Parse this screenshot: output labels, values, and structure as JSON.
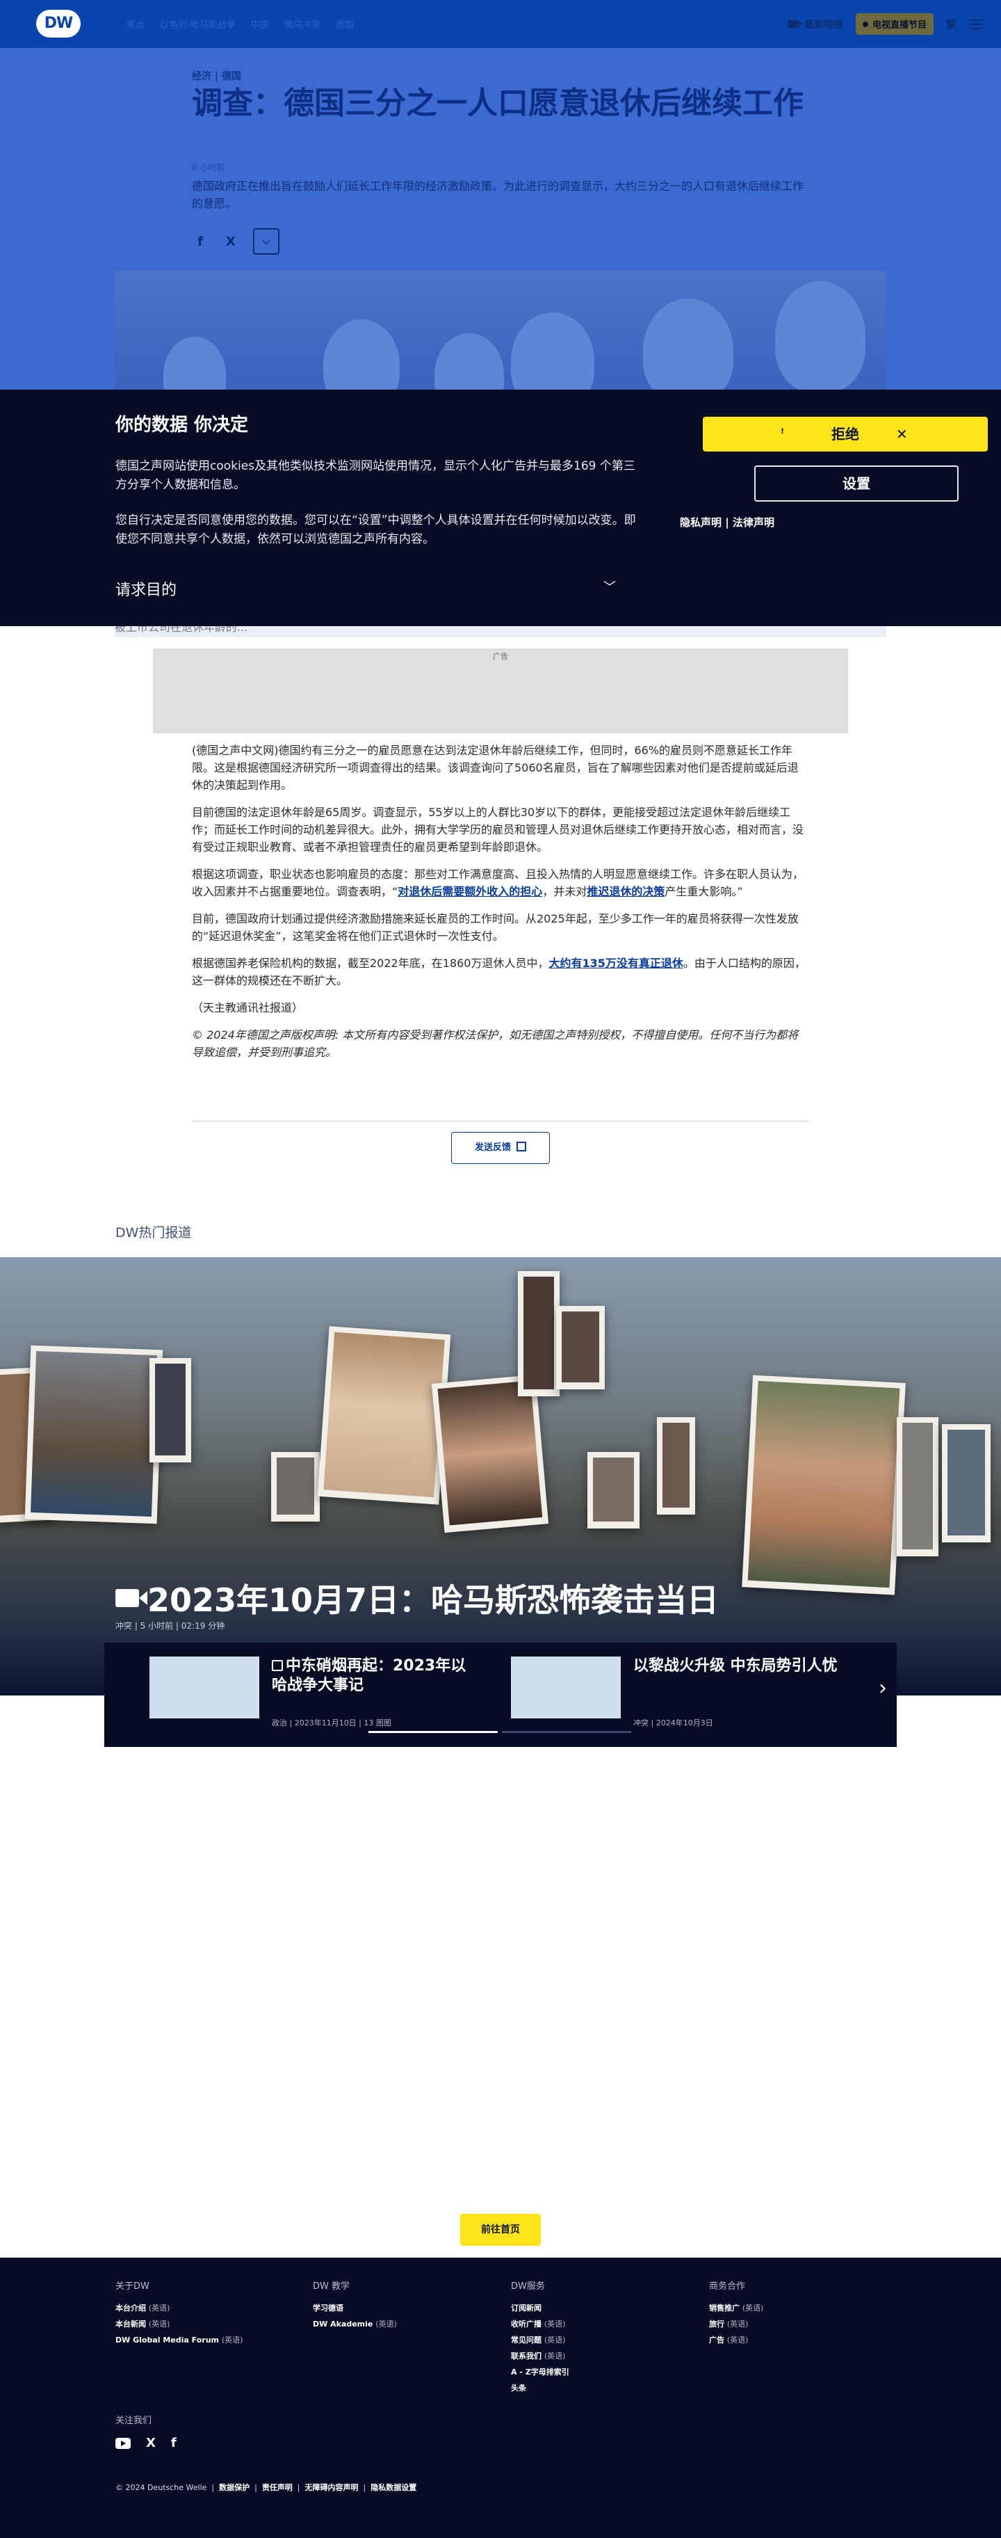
{
  "brand": {
    "logo_text": "DW"
  },
  "nav": {
    "links": [
      "焦点",
      "以色列-哈马斯战争",
      "中国",
      "俄乌冲突",
      "德国"
    ],
    "latest_label": "最新视频",
    "live_label": "电视直播节目",
    "lang_label": "繁"
  },
  "article": {
    "kicker": "经济 | 德国",
    "title": "调查：德国三分之一人口愿意退休后继续工作",
    "time": "6 小时前",
    "teaser": "德国政府正在推出旨在鼓励人们延长工作年限的经济激励政策。为此进行的调查显示，大约三分之一的人口有退休后继续工作的意愿。",
    "share": {
      "facebook": "f",
      "x": "X",
      "more": "⌵"
    }
  },
  "cookie": {
    "title": "你的数据 你决定",
    "p1": "德国之声网站使用cookies及其他类似技术监测网站使用情况，显示个人化广告并与最多169 个第三方分享个人数据和信息。",
    "p2": "您自行决定是否同意使用您的数据。您可以在“设置”中调整个人具体设置并在任何时候加以改变。即使您不同意共享个人数据，依然可以浏览德国之声所有内容。",
    "purposes_label": "请求目的",
    "reject_label": "拒绝",
    "settings_label": "设置",
    "privacy_link": "隐私声明",
    "legal_link": "法律声明",
    "link_sep": "|"
  },
  "body": {
    "subbar_text": "被上市公司在退休年龄的...",
    "ad_label": "广告",
    "p1": "(德国之声中文网)德国约有三分之一的雇员愿意在达到法定退休年龄后继续工作，但同时，66%的雇员则不愿意延长工作年限。这是根据德国经济研究所一项调查得出的结果。该调查询问了5060名雇员，旨在了解哪些因素对他们是否提前或延后退休的决策起到作用。",
    "p2": "目前德国的法定退休年龄是65周岁。调查显示，55岁以上的人群比30岁以下的群体，更能接受超过法定退休年龄后继续工作；而延长工作时间的动机差异很大。此外，拥有大学学历的雇员和管理人员对退休后继续工作更持开放心态，相对而言，没有受过正规职业教育、或者不承担管理责任的雇员更希望到年龄即退休。",
    "p3_before": "根据这项调查，职业状态也影响雇员的态度：那些对工作满意度高、且投入热情的人明显愿意继续工作。许多在职人员认为，收入因素并不占据重要地位。调查表明，“",
    "p3_link1": "对退休后需要额外收入的担心",
    "p3_mid": "，并未对",
    "p3_link2": "推迟退休的决策",
    "p3_after": "产生重大影响。”",
    "p4": "目前，德国政府计划通过提供经济激励措施来延长雇员的工作时间。从2025年起，至少多工作一年的雇员将获得一次性发放的“延迟退休奖金”，这笔奖金将在他们正式退休时一次性支付。",
    "p5_before": "根据德国养老保险机构的数据，截至2022年底，在1860万退休人员中，",
    "p5_link": "大约有135万没有真正退休",
    "p5_after": "。由于人口结构的原因，这一群体的规模还在不断扩大。",
    "p6": "（天主教通讯社报道）",
    "copyright": "© 2024年德国之声版权声明: 本文所有内容受到著作权法保护，如无德国之声特别授权，不得擅自使用。任何不当行为都将导致追偿，并受到刑事追究。",
    "feedback_label": "发送反馈"
  },
  "hot": {
    "section_title": "DW热门报道",
    "title": "2023年10月7日：哈马斯恐怖袭击当日",
    "meta": "冲突 | 5 小时前 | 02:19 分钟",
    "cards": [
      {
        "title": "中东硝烟再起：2023年以哈战争大事记",
        "meta": "政治 | 2023年11月10日 | 13 图图"
      },
      {
        "title": "以黎战火升级 中东局势引人忧",
        "meta": "冲突 | 2024年10月3日"
      }
    ],
    "next_icon": "›"
  },
  "home_button_label": "前往首页",
  "footer": {
    "cols": [
      {
        "title": "关于DW",
        "items": [
          {
            "label": "本台介绍",
            "lang": "(英语)"
          },
          {
            "label": "本台新闻",
            "lang": "(英语)"
          },
          {
            "label": "DW Global Media Forum",
            "lang": "(英语)"
          }
        ]
      },
      {
        "title": "DW 教学",
        "items": [
          {
            "label": "学习德语",
            "lang": ""
          },
          {
            "label": "DW Akademie",
            "lang": "(英语)"
          }
        ]
      },
      {
        "title": "DW服务",
        "items": [
          {
            "label": "订阅新闻",
            "lang": ""
          },
          {
            "label": "收听广播",
            "lang": "(英语)"
          },
          {
            "label": "常见问题",
            "lang": "(英语)"
          },
          {
            "label": "联系我们",
            "lang": "(英语)"
          },
          {
            "label": "A - Z字母排索引",
            "lang": ""
          },
          {
            "label": "头条",
            "lang": ""
          }
        ]
      },
      {
        "title": "商务合作",
        "items": [
          {
            "label": "销售推广",
            "lang": "(英语)"
          },
          {
            "label": "旅行",
            "lang": "(英语)"
          },
          {
            "label": "广告",
            "lang": "(英语)"
          }
        ]
      }
    ],
    "follow_label": "关注我们",
    "social": {
      "x": "X",
      "facebook": "f"
    },
    "copyright": "© 2024 Deutsche Welle",
    "legal_links": [
      "数据保护",
      "责任声明",
      "无障碍内容声明",
      "隐私数据设置"
    ]
  },
  "colors": {
    "brand_blue": "#0a44ad",
    "banner_dark": "#050c24",
    "accent_yellow": "#ffe41c",
    "link_blue": "#0a3c9c"
  }
}
